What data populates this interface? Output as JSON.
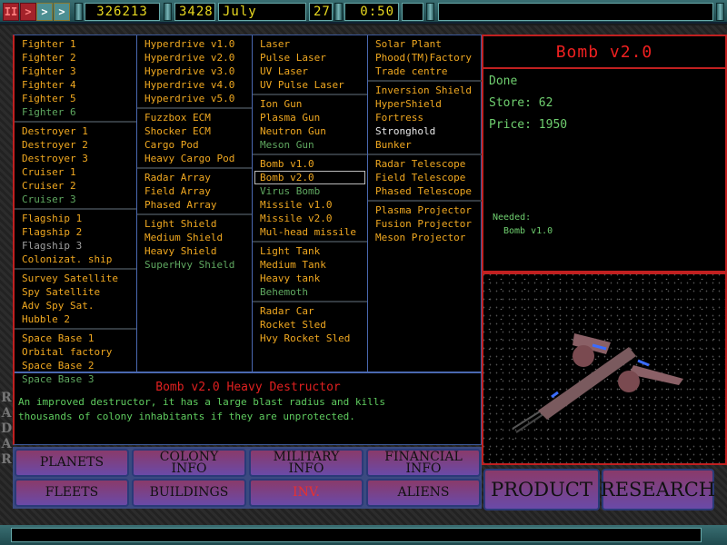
{
  "topbar": {
    "pause_icon": "pause-icon",
    "play_icon": "play-icon",
    "fast_icon": "fast-forward-icon",
    "faster_icon": "faster-forward-icon",
    "credits": "326213",
    "stardate_value": "3428",
    "month": "July",
    "day": "27",
    "time": "0:50",
    "empty_slot": "",
    "message": ""
  },
  "side_label": "RADAR",
  "columns": [
    {
      "groups": [
        [
          {
            "label": "Fighter 1",
            "state": "available"
          },
          {
            "label": "Fighter 2",
            "state": "available"
          },
          {
            "label": "Fighter 3",
            "state": "available"
          },
          {
            "label": "Fighter 4",
            "state": "available"
          },
          {
            "label": "Fighter 5",
            "state": "available"
          },
          {
            "label": "Fighter 6",
            "state": "researchable"
          }
        ],
        [
          {
            "label": "Destroyer 1",
            "state": "available"
          },
          {
            "label": "Destroyer 2",
            "state": "available"
          },
          {
            "label": "Destroyer 3",
            "state": "available"
          },
          {
            "label": "Cruiser 1",
            "state": "available"
          },
          {
            "label": "Cruiser 2",
            "state": "available"
          },
          {
            "label": "Cruiser 3",
            "state": "researchable"
          }
        ],
        [
          {
            "label": "Flagship 1",
            "state": "available"
          },
          {
            "label": "Flagship 2",
            "state": "available"
          },
          {
            "label": "Flagship 3",
            "state": "unavailable"
          },
          {
            "label": "Colonizat. ship",
            "state": "available"
          }
        ],
        [
          {
            "label": "Survey Satellite",
            "state": "available"
          },
          {
            "label": "Spy Satellite",
            "state": "available"
          },
          {
            "label": "Adv Spy Sat.",
            "state": "available"
          },
          {
            "label": "Hubble 2",
            "state": "available"
          }
        ],
        [
          {
            "label": "Space Base 1",
            "state": "available"
          },
          {
            "label": "Orbital factory",
            "state": "available"
          },
          {
            "label": "Space Base 2",
            "state": "available"
          },
          {
            "label": "Space Base 3",
            "state": "researchable"
          }
        ]
      ]
    },
    {
      "groups": [
        [
          {
            "label": "Hyperdrive v1.0",
            "state": "available"
          },
          {
            "label": "Hyperdrive v2.0",
            "state": "available"
          },
          {
            "label": "Hyperdrive v3.0",
            "state": "available"
          },
          {
            "label": "Hyperdrive v4.0",
            "state": "available"
          },
          {
            "label": "Hyperdrive v5.0",
            "state": "available"
          }
        ],
        [
          {
            "label": "Fuzzbox ECM",
            "state": "available"
          },
          {
            "label": "Shocker ECM",
            "state": "available"
          },
          {
            "label": "Cargo Pod",
            "state": "available"
          },
          {
            "label": "Heavy Cargo Pod",
            "state": "available"
          }
        ],
        [
          {
            "label": "Radar Array",
            "state": "available"
          },
          {
            "label": "Field Array",
            "state": "available"
          },
          {
            "label": "Phased Array",
            "state": "available"
          }
        ],
        [
          {
            "label": "Light Shield",
            "state": "available"
          },
          {
            "label": "Medium Shield",
            "state": "available"
          },
          {
            "label": "Heavy Shield",
            "state": "available"
          },
          {
            "label": "SuperHvy Shield",
            "state": "researchable"
          }
        ]
      ]
    },
    {
      "groups": [
        [
          {
            "label": "Laser",
            "state": "available"
          },
          {
            "label": "Pulse Laser",
            "state": "available"
          },
          {
            "label": "UV Laser",
            "state": "available"
          },
          {
            "label": "UV Pulse Laser",
            "state": "available"
          }
        ],
        [
          {
            "label": "Ion Gun",
            "state": "available"
          },
          {
            "label": "Plasma Gun",
            "state": "available"
          },
          {
            "label": "Neutron Gun",
            "state": "available"
          },
          {
            "label": "Meson Gun",
            "state": "researchable"
          }
        ],
        [
          {
            "label": "Bomb v1.0",
            "state": "available"
          },
          {
            "label": "Bomb v2.0",
            "state": "available",
            "selected": true
          },
          {
            "label": "Virus Bomb",
            "state": "researchable"
          },
          {
            "label": "Missile v1.0",
            "state": "available"
          },
          {
            "label": "Missile v2.0",
            "state": "available"
          },
          {
            "label": "Mul-head missile",
            "state": "available"
          }
        ],
        [
          {
            "label": "Light Tank",
            "state": "available"
          },
          {
            "label": "Medium Tank",
            "state": "available"
          },
          {
            "label": "Heavy tank",
            "state": "available"
          },
          {
            "label": "Behemoth",
            "state": "researchable"
          }
        ],
        [
          {
            "label": "Radar Car",
            "state": "available"
          },
          {
            "label": "Rocket Sled",
            "state": "available"
          },
          {
            "label": "Hvy Rocket Sled",
            "state": "available"
          }
        ]
      ]
    },
    {
      "groups": [
        [
          {
            "label": "Solar Plant",
            "state": "available"
          },
          {
            "label": "Phood(TM)Factory",
            "state": "available"
          },
          {
            "label": "Trade centre",
            "state": "available"
          }
        ],
        [
          {
            "label": "Inversion Shield",
            "state": "available"
          },
          {
            "label": "HyperShield",
            "state": "available"
          },
          {
            "label": "Fortress",
            "state": "available"
          },
          {
            "label": "Stronghold",
            "state": "current"
          },
          {
            "label": "Bunker",
            "state": "available"
          }
        ],
        [
          {
            "label": "Radar Telescope",
            "state": "available"
          },
          {
            "label": "Field Telescope",
            "state": "available"
          },
          {
            "label": "Phased Telescope",
            "state": "available"
          }
        ],
        [
          {
            "label": "Plasma Projector",
            "state": "available"
          },
          {
            "label": "Fusion Projector",
            "state": "available"
          },
          {
            "label": "Meson Projector",
            "state": "available"
          }
        ]
      ]
    }
  ],
  "description": {
    "title": "Bomb v2.0 Heavy Destructor",
    "text_line1": "An improved destructor, it has a large blast radius and kills",
    "text_line2": "thousands of colony inhabitants if they are unprotected."
  },
  "info": {
    "title": "Bomb v2.0",
    "status": "Done",
    "store": "Store: 62",
    "price": "Price: 1950",
    "needed_label": "Needed:",
    "needed_item": "Bomb v1.0",
    "image_label": "bomb-v2-ship-render"
  },
  "nav": {
    "planets": "PLANETS",
    "colony_info_1": "COLONY",
    "colony_info_2": "INFO",
    "military_info_1": "MILITARY",
    "military_info_2": "INFO",
    "financial_info_1": "FINANCIAL",
    "financial_info_2": "INFO",
    "fleets": "FLEETS",
    "buildings": "BUILDINGS",
    "inv": "INV.",
    "aliens": "ALIENS"
  },
  "actions": {
    "product": "PRODUCT",
    "research": "RESEARCH"
  },
  "colors": {
    "available": "#f0a820",
    "researchable": "#5fa860",
    "unavailable": "#a0a0a0",
    "current": "#e8e8e8",
    "title_red": "#ee2020",
    "info_green": "#6fcf6f"
  }
}
